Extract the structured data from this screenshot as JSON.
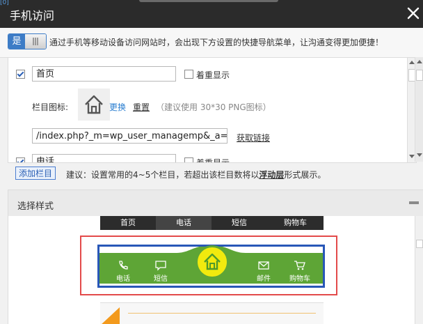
{
  "window": {
    "title": "手机访问",
    "close_icon": "close-icon"
  },
  "switch": {
    "on_label": "是"
  },
  "description": "通过手机等移动设备访问网站时，会出现下方设置的快捷导航菜单，让沟通变得更加便捷！",
  "items": [
    {
      "name": "首页",
      "highlight_label": "着重显示",
      "checked": true
    },
    {
      "name": "电话",
      "highlight_label": "着重显示",
      "checked": true
    }
  ],
  "icon_row": {
    "label": "栏目图标:",
    "change": "更换",
    "reset": "重置",
    "hint": "（建议使用 30*30 PNG图标）"
  },
  "link_row": {
    "value": "/index.php?_m=wp_user_managemp&_a=user.",
    "get_link": "获取链接"
  },
  "add_button": "添加栏目",
  "add_tip_prefix": "建议：设置常用的4~5个栏目，若超出该栏目数将以",
  "add_tip_bold": "浮动层",
  "add_tip_suffix": "形式展示。",
  "style_section": {
    "title": "选择样式"
  },
  "style_dark": [
    "首页",
    "电话",
    "短信",
    "购物车"
  ],
  "style_green": [
    "电话",
    "短信",
    "邮件",
    "购物车"
  ],
  "colors": {
    "accent_blue": "#3d7cc6",
    "green": "#5ea536",
    "yellow": "#f1ea0e",
    "red_frame": "#e34a4a",
    "blue_frame": "#2857b8"
  }
}
